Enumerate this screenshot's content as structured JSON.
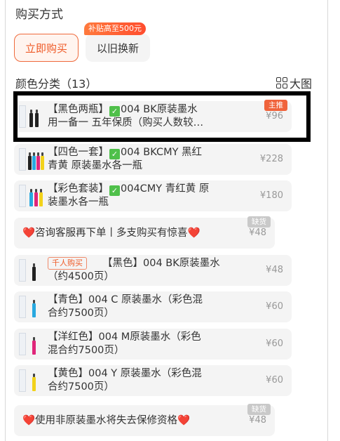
{
  "purchase": {
    "title": "购买方式",
    "buy_now": "立即购买",
    "trade_in": "以旧换新",
    "subsidy_badge": "补贴高至500元"
  },
  "colors": {
    "heading": "颜色分类（13）",
    "big_view": "大图",
    "items": [
      {
        "line1": "【黑色两瓶】",
        "check": "✓",
        "line1b": "004 BK原装墨水",
        "line2": "用一备一 五年保质（购买人数较…",
        "price": "¥96",
        "tag": "主推"
      },
      {
        "line1": "【四色一套】",
        "check": "✓",
        "line1b": "004 BKCMY 黑红",
        "line2": "青黄 原装墨水各一瓶",
        "price": "¥228"
      },
      {
        "line1": "【彩色套装】",
        "check": "✓",
        "line1b": "004CMY 青红黄 原",
        "line2": "装墨水各一瓶",
        "price": "¥180"
      },
      {
        "text": "❤️咨询客服再下单丨多支购买有惊喜❤️",
        "price": "¥48",
        "tag": "缺货"
      },
      {
        "sold": "千人购买",
        "line1": "【黑色】004 BK原装墨水",
        "line2": "（约4500页）",
        "price": "¥48"
      },
      {
        "line1": "【青色】004 C 原装墨水（彩色混",
        "line2": "合约7500页）",
        "price": "¥60"
      },
      {
        "line1": "【洋红色】004 M原装墨水（彩色",
        "line2": "混合约7500页）",
        "price": "¥60"
      },
      {
        "line1": "【黄色】004 Y 原装墨水（彩色混",
        "line2": "合约7500页）",
        "price": "¥60"
      },
      {
        "text": "❤️使用非原装墨水将失去保修资格❤️",
        "price": "¥48",
        "tag": "缺货"
      }
    ]
  }
}
